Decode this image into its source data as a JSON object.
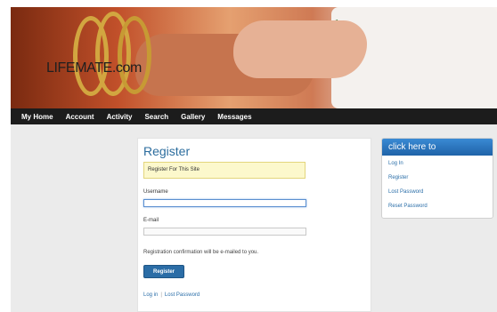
{
  "brand": {
    "name": "LIFEMATE.com"
  },
  "nav": {
    "items": [
      {
        "label": "My Home"
      },
      {
        "label": "Account"
      },
      {
        "label": "Activity"
      },
      {
        "label": "Search"
      },
      {
        "label": "Gallery"
      },
      {
        "label": "Messages"
      }
    ]
  },
  "register": {
    "title": "Register",
    "notice": "Register For This Site",
    "username_label": "Username",
    "username_value": "",
    "email_label": "E-mail",
    "email_value": "",
    "confirmation": "Registration confirmation will be e-mailed to you.",
    "button_label": "Register",
    "links": {
      "login": "Log in",
      "separator": "|",
      "lost_password": "Lost Password"
    }
  },
  "sidebar": {
    "heading": "click here to",
    "links": [
      {
        "label": "Log In"
      },
      {
        "label": "Register"
      },
      {
        "label": "Lost Password"
      },
      {
        "label": "Reset Password"
      }
    ]
  },
  "colors": {
    "navbar": "#1c1c1c",
    "accent": "#2c6d9e",
    "notice_bg": "#fcf8cc",
    "sidebar_header": "#2b77c0"
  }
}
